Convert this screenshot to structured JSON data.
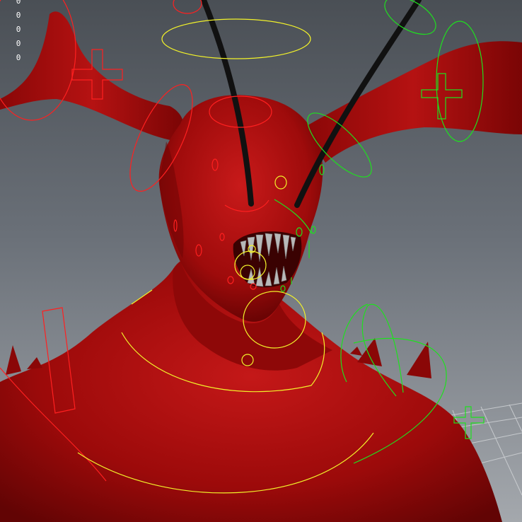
{
  "viewport": {
    "hud_values": [
      "0",
      "0",
      "0",
      "0",
      "0"
    ]
  },
  "colors": {
    "background_top": "#4a4f55",
    "background_bottom": "#a4a8ad",
    "mesh_red": "#9c0a0a",
    "mesh_red_light": "#c21515",
    "mesh_red_dark": "#5e0303",
    "control_red": "#ff2020",
    "control_yellow": "#f2f22a",
    "control_green": "#1fe01f",
    "teeth": "#b8b8b8",
    "antenna": "#111111",
    "grid": "#d0d3d6"
  },
  "icons": [
    "move-cross-icon",
    "circle-control-icon",
    "ellipse-control-icon"
  ]
}
